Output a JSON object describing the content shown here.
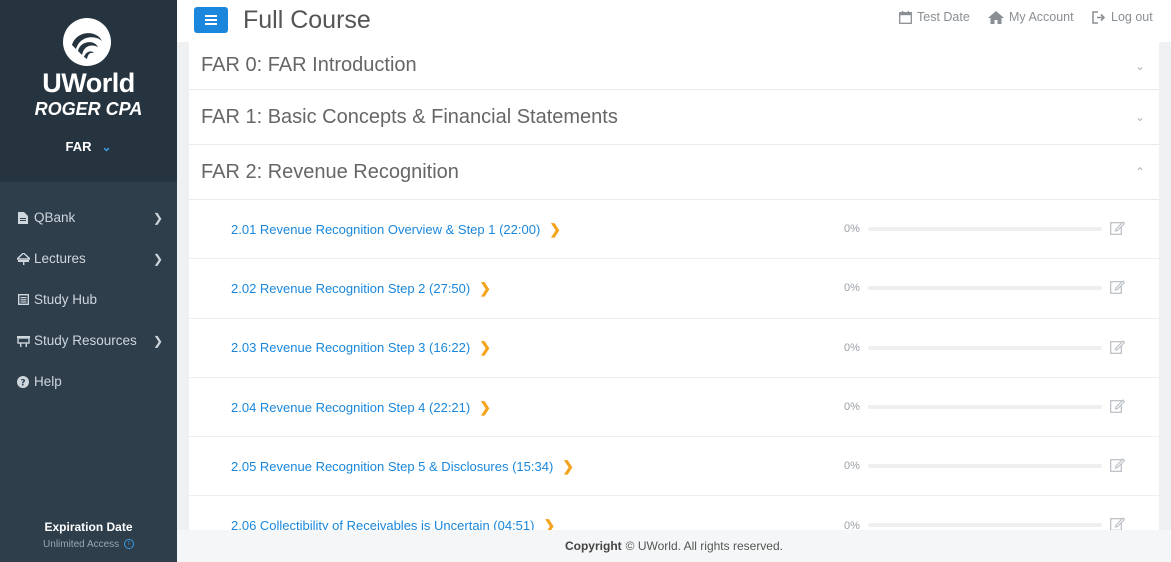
{
  "brand": {
    "name": "UWorld",
    "sub": "ROGER CPA",
    "section": "FAR"
  },
  "nav": [
    {
      "label": "QBank",
      "icon": "document-icon",
      "has_arrow": true
    },
    {
      "label": "Lectures",
      "icon": "projector-icon",
      "has_arrow": true
    },
    {
      "label": "Study Hub",
      "icon": "list-icon",
      "has_arrow": false
    },
    {
      "label": "Study Resources",
      "icon": "board-icon",
      "has_arrow": true
    },
    {
      "label": "Help",
      "icon": "help-icon",
      "has_arrow": false
    }
  ],
  "expiry": {
    "title": "Expiration Date",
    "value": "Unlimited Access"
  },
  "header": {
    "title": "Full Course",
    "test_date": "Test Date",
    "my_account": "My Account",
    "log_out": "Log out"
  },
  "modules": [
    {
      "title": "FAR 0: FAR Introduction",
      "expanded": false
    },
    {
      "title": "FAR 1: Basic Concepts & Financial Statements",
      "expanded": false
    },
    {
      "title": "FAR 2: Revenue Recognition",
      "expanded": true
    }
  ],
  "lessons": [
    {
      "title": "2.01 Revenue Recognition Overview & Step 1 (22:00)",
      "progress": "0%",
      "progress_value": 0
    },
    {
      "title": "2.02 Revenue Recognition Step 2 (27:50)",
      "progress": "0%",
      "progress_value": 0
    },
    {
      "title": "2.03 Revenue Recognition Step 3 (16:22)",
      "progress": "0%",
      "progress_value": 0
    },
    {
      "title": "2.04 Revenue Recognition Step 4 (22:21)",
      "progress": "0%",
      "progress_value": 0
    },
    {
      "title": "2.05 Revenue Recognition Step 5 & Disclosures (15:34)",
      "progress": "0%",
      "progress_value": 0
    },
    {
      "title": "2.06 Collectibility of Receivables is Uncertain (04:51)",
      "progress": "0%",
      "progress_value": 0
    }
  ],
  "footer": {
    "bold": "Copyright",
    "text": "© UWorld. All rights reserved."
  },
  "colors": {
    "accent": "#1a87dc",
    "sidebar": "#2e3e4b",
    "arrow": "#f3a41c"
  }
}
